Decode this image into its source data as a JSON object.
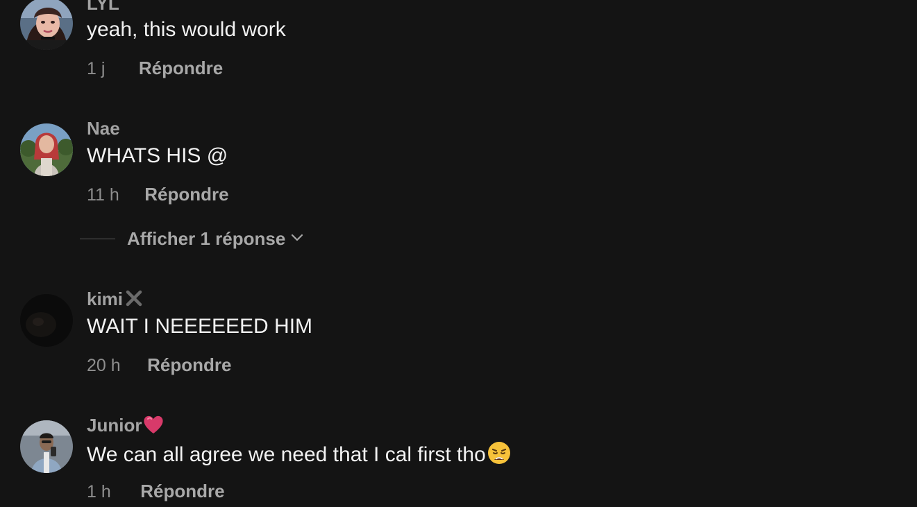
{
  "comments": [
    {
      "username": "LYL",
      "text": "yeah, this would work",
      "time": "1 j",
      "reply_label": "Répondre",
      "avatar_icon": "profile-photo-woman-selfie"
    },
    {
      "username": "Nae",
      "text": "WHATS HIS @",
      "time": "11 h",
      "reply_label": "Répondre",
      "avatar_icon": "profile-photo-woman-outdoors"
    },
    {
      "username": "kimi",
      "username_badge": "cross-mark-emoji",
      "text": "WAIT I NEEEEEED HIM",
      "time": "20 h",
      "reply_label": "Répondre",
      "avatar_icon": "profile-photo-dark"
    },
    {
      "username": "Junior",
      "username_badge": "pink-heart-emoji",
      "text": "We can all agree we need that I cal first tho",
      "text_emoji": "weary-face-emoji",
      "time": "1 h",
      "reply_label": "Répondre",
      "avatar_icon": "profile-photo-man-mirror"
    }
  ],
  "view_replies": {
    "label": "Afficher 1 réponse",
    "icon": "chevron-down-icon"
  },
  "colors": {
    "background": "#141414",
    "username": "#a3a3a3",
    "text": "#f2f2f2",
    "meta": "#8e8e8e",
    "reply": "#a8a8a8"
  }
}
